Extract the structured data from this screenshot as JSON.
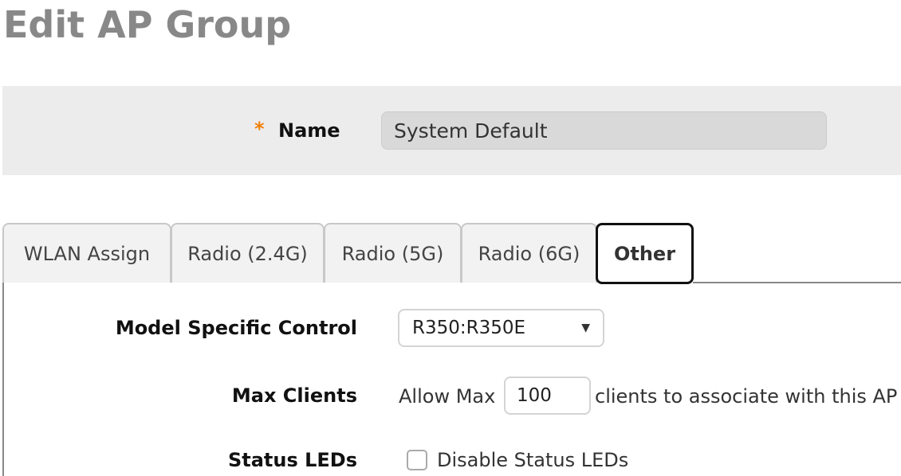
{
  "page_title": "Edit AP Group",
  "name_field": {
    "required_mark": "*",
    "label": "Name",
    "value": "System Default"
  },
  "tabs": [
    {
      "label": "WLAN Assign",
      "active": false
    },
    {
      "label": "Radio (2.4G)",
      "active": false
    },
    {
      "label": "Radio (5G)",
      "active": false
    },
    {
      "label": "Radio (6G)",
      "active": false
    },
    {
      "label": "Other",
      "active": true
    }
  ],
  "other": {
    "model_specific_control": {
      "label": "Model Specific Control",
      "selected": "R350:R350E"
    },
    "max_clients": {
      "label": "Max Clients",
      "prefix": "Allow Max",
      "value": "100",
      "suffix": "clients to associate with this AP"
    },
    "status_leds": {
      "label": "Status LEDs",
      "checkbox_label": "Disable Status LEDs",
      "checked": false
    }
  },
  "colors": {
    "required": "#f0800a",
    "title": "#888888"
  }
}
